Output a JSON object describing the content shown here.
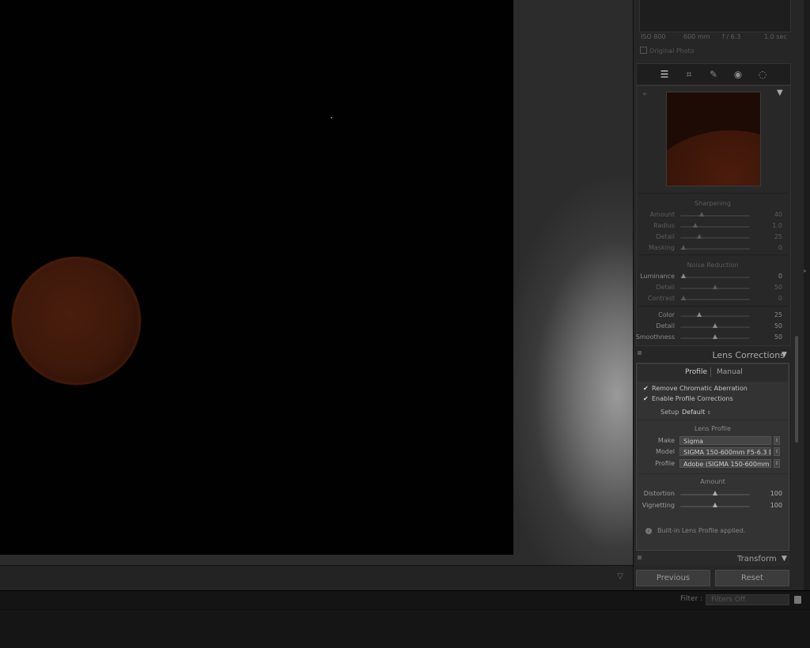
{
  "histogram": {
    "iso": "ISO 800",
    "focal": "600 mm",
    "aperture": "f / 6.3",
    "shutter": "1.0 sec"
  },
  "original_photo": "Original Photo",
  "tools": [
    "edit-sliders-icon",
    "crop-icon",
    "healing-icon",
    "red-eye-icon",
    "mask-icon"
  ],
  "sharpening": {
    "title": "Sharpening",
    "sliders": [
      {
        "label": "Amount",
        "value": "40",
        "pos": 0.31
      },
      {
        "label": "Radius",
        "value": "1.0",
        "pos": 0.22
      },
      {
        "label": "Detail",
        "value": "25",
        "pos": 0.27
      },
      {
        "label": "Masking",
        "value": "0",
        "pos": 0.04
      }
    ]
  },
  "noise_reduction": {
    "title": "Noise Reduction",
    "sliders": [
      {
        "label": "Luminance",
        "value": "0",
        "pos": 0.04
      },
      {
        "label": "Detail",
        "value": "50",
        "pos": 0.5
      },
      {
        "label": "Contrast",
        "value": "0",
        "pos": 0.04
      },
      {
        "label": "Color",
        "value": "25",
        "pos": 0.27
      },
      {
        "label": "Detail",
        "value": "50",
        "pos": 0.5
      },
      {
        "label": "Smoothness",
        "value": "50",
        "pos": 0.5
      }
    ]
  },
  "lens_corrections": {
    "title": "Lens Corrections",
    "tabs": {
      "profile": "Profile",
      "manual": "Manual"
    },
    "remove_ca": "Remove Chromatic Aberration",
    "enable_profile": "Enable Profile Corrections",
    "setup_label": "Setup",
    "setup_value": "Default",
    "lens_profile_title": "Lens Profile",
    "make_label": "Make",
    "make_value": "Sigma",
    "model_label": "Model",
    "model_value": "SIGMA 150-600mm F5-6.3 D...",
    "profile_label": "Profile",
    "profile_value": "Adobe (SIGMA 150-600mm F...",
    "amount_title": "Amount",
    "distortion_label": "Distortion",
    "distortion_value": "100",
    "distortion_pos": 0.5,
    "vignetting_label": "Vignetting",
    "vignetting_value": "100",
    "vignetting_pos": 0.5,
    "info": "Built-in Lens Profile applied."
  },
  "transform": {
    "title": "Transform"
  },
  "buttons": {
    "previous": "Previous",
    "reset": "Reset"
  },
  "filter": {
    "label": "Filter :",
    "value": "Filters Off"
  }
}
